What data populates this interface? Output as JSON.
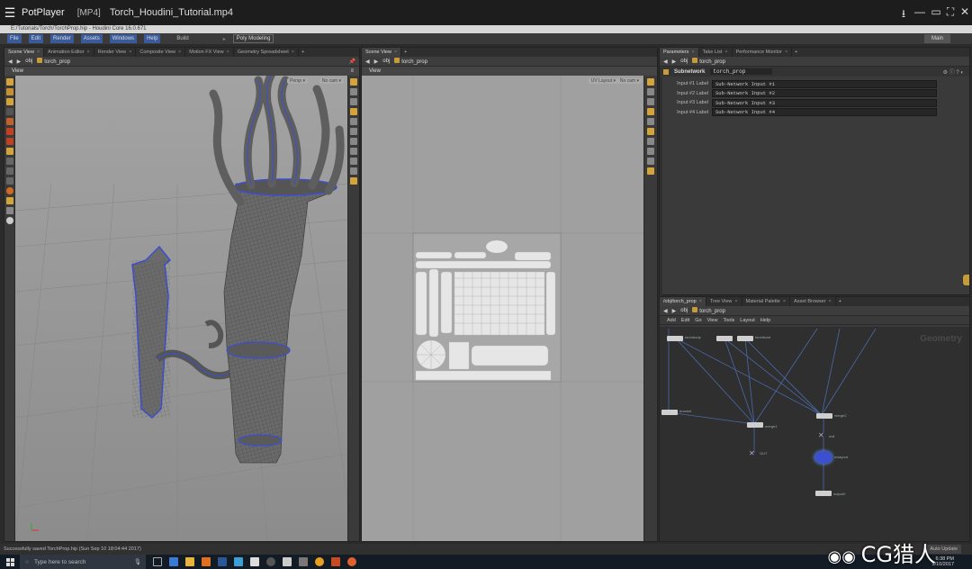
{
  "player": {
    "app_name": "PotPlayer",
    "format": "[MP4]",
    "file_name": "Torch_Houdini_Tutorial.mp4"
  },
  "houdini": {
    "title": "E:/Tutorials/Torch/TorchProp.hip - Houdini Core 16.0.671",
    "menu": [
      "File",
      "Edit",
      "Render",
      "Assets",
      "Windows",
      "Help"
    ],
    "shelf_left": "Build",
    "shelf_current": "Poly Modeling",
    "desktop": "Main"
  },
  "scene_pane": {
    "tabs": [
      "Scene View",
      "Animation Editor",
      "Render View",
      "Composite View",
      "Motion FX View",
      "Geometry Spreadsheet"
    ],
    "path": [
      "obj",
      "torch_prop"
    ],
    "view_label": "View",
    "overlay_left": "Persp ▾",
    "overlay_right": "No cam ▾"
  },
  "uv_pane": {
    "tabs": [
      "Scene View"
    ],
    "path": [
      "obj",
      "torch_prop"
    ],
    "view_label": "View",
    "overlay_left": "UV Layout ▾",
    "overlay_right": "No cam ▾"
  },
  "param_pane": {
    "tabs": [
      "Parameters",
      "Take List",
      "Performance Monitor"
    ],
    "path": [
      "obj",
      "torch_prop"
    ],
    "node_type": "Subnetwork",
    "node_name": "torch_prop",
    "params": [
      {
        "label": "Input #1 Label",
        "value": "Sub-Network Input #1"
      },
      {
        "label": "Input #2 Label",
        "value": "Sub-Network Input #2"
      },
      {
        "label": "Input #3 Label",
        "value": "Sub-Network Input #3"
      },
      {
        "label": "Input #4 Label",
        "value": "Sub-Network Input #4"
      }
    ]
  },
  "network_pane": {
    "tabs": [
      "/obj/torch_prop",
      "Tree View",
      "Material Palette",
      "Asset Browser"
    ],
    "path": [
      "obj",
      "torch_prop"
    ],
    "menu": [
      "Add",
      "Edit",
      "Go",
      "View",
      "Tools",
      "Layout",
      "Help"
    ],
    "context_label": "Geometry",
    "nodes": [
      {
        "id": "n1",
        "label": "torchbody"
      },
      {
        "id": "n2",
        "label": "torchbowl"
      },
      {
        "id": "n3",
        "label": "bracket"
      },
      {
        "id": "n4",
        "label": "merge1"
      },
      {
        "id": "n5",
        "label": "merge2"
      },
      {
        "id": "n6",
        "label": "null"
      },
      {
        "id": "n7",
        "label": "uvlayout"
      },
      {
        "id": "n8",
        "label": "OUT"
      },
      {
        "id": "n9",
        "label": "material"
      },
      {
        "id": "n10",
        "label": "output0"
      }
    ]
  },
  "status": {
    "message": "Successfully saved TorchProp.hip (Sun Sep 10 18:04:44 2017)",
    "autoupdate": "Auto Update"
  },
  "taskbar": {
    "search_placeholder": "Type here to search",
    "time": "6:38 PM",
    "date": "9/10/2017"
  },
  "watermark": "CG猎人",
  "colors": {
    "wire_blue": "#4a6aa8",
    "selection_blue": "#3b4fd0",
    "node_orange": "#c79a3a"
  }
}
